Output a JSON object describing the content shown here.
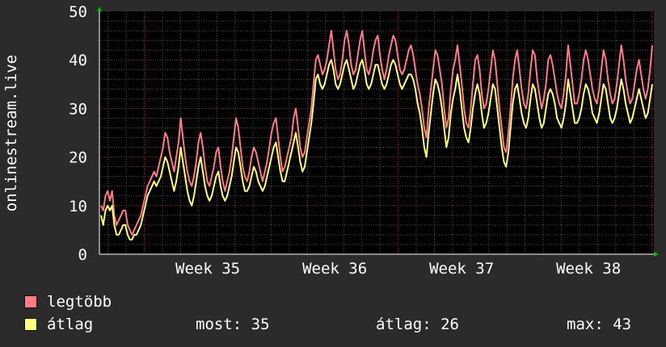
{
  "chart_data": {
    "type": "line",
    "ylabel": "onlinestream.live",
    "ylim": [
      0,
      50
    ],
    "yticks": [
      0,
      10,
      20,
      30,
      40,
      50
    ],
    "xticks": [
      "Week 35",
      "Week 36",
      "Week 37",
      "Week 38"
    ],
    "grid": true,
    "legend_position": "bottom-left",
    "series": [
      {
        "name": "legtöbb",
        "color": "#ff7b85",
        "values": [
          10,
          9,
          12,
          13,
          11,
          13,
          8,
          6,
          7,
          8,
          9,
          9,
          6,
          5,
          4,
          5,
          6,
          7,
          8,
          10,
          12,
          14,
          15,
          16,
          17,
          16,
          18,
          20,
          22,
          25,
          24,
          21,
          19,
          17,
          20,
          23,
          28,
          24,
          20,
          17,
          15,
          14,
          16,
          19,
          23,
          25,
          22,
          18,
          15,
          14,
          16,
          18,
          21,
          22,
          18,
          15,
          13,
          15,
          17,
          20,
          24,
          28,
          26,
          22,
          18,
          16,
          15,
          17,
          20,
          22,
          21,
          19,
          17,
          15,
          17,
          19,
          22,
          25,
          27,
          28,
          24,
          20,
          17,
          18,
          20,
          22,
          24,
          28,
          30,
          26,
          22,
          20,
          21,
          24,
          27,
          30,
          35,
          40,
          41,
          39,
          37,
          38,
          40,
          43,
          46,
          42,
          38,
          36,
          37,
          40,
          44,
          46,
          43,
          39,
          37,
          38,
          41,
          44,
          46,
          42,
          38,
          37,
          39,
          42,
          44,
          45,
          41,
          38,
          36,
          38,
          41,
          43,
          45,
          44,
          41,
          38,
          37,
          38,
          40,
          42,
          43,
          41,
          38,
          35,
          33,
          30,
          26,
          24,
          30,
          34,
          38,
          42,
          41,
          38,
          35,
          30,
          26,
          28,
          34,
          38,
          40,
          43,
          39,
          35,
          30,
          27,
          26,
          30,
          35,
          40,
          41,
          38,
          33,
          30,
          31,
          34,
          38,
          42,
          40,
          35,
          30,
          26,
          22,
          21,
          25,
          30,
          36,
          40,
          42,
          38,
          34,
          31,
          30,
          33,
          38,
          42,
          41,
          36,
          33,
          30,
          32,
          35,
          40,
          41,
          39,
          36,
          33,
          31,
          30,
          33,
          37,
          43,
          39,
          35,
          31,
          31,
          33,
          36,
          40,
          42,
          40,
          37,
          34,
          32,
          31,
          34,
          38,
          42,
          40,
          36,
          33,
          31,
          32,
          35,
          39,
          43,
          40,
          36,
          33,
          31,
          32,
          35,
          38,
          40,
          37,
          34,
          32,
          34,
          38,
          43
        ],
        "now": "",
        "avg": "",
        "max": ""
      },
      {
        "name": "átlag",
        "color": "#ffff80",
        "values": [
          8,
          6,
          9,
          10,
          9,
          10,
          6,
          4,
          4,
          5,
          6,
          6,
          4,
          3,
          3,
          4,
          4,
          5,
          6,
          8,
          10,
          12,
          13,
          14,
          15,
          14,
          15,
          16,
          18,
          20,
          19,
          17,
          15,
          13,
          15,
          18,
          22,
          19,
          16,
          13,
          11,
          10,
          12,
          15,
          18,
          20,
          17,
          14,
          12,
          11,
          12,
          14,
          16,
          17,
          14,
          12,
          11,
          12,
          14,
          16,
          19,
          22,
          21,
          18,
          15,
          13,
          13,
          14,
          16,
          18,
          17,
          15,
          14,
          13,
          14,
          16,
          18,
          20,
          22,
          23,
          20,
          17,
          15,
          15,
          17,
          19,
          21,
          23,
          25,
          22,
          19,
          17,
          18,
          21,
          24,
          27,
          31,
          36,
          37,
          35,
          34,
          35,
          37,
          39,
          40,
          38,
          35,
          34,
          35,
          37,
          39,
          40,
          38,
          36,
          34,
          35,
          37,
          39,
          40,
          38,
          35,
          34,
          35,
          37,
          39,
          39,
          37,
          35,
          34,
          35,
          37,
          39,
          40,
          39,
          37,
          35,
          34,
          35,
          36,
          37,
          37,
          36,
          34,
          31,
          29,
          26,
          22,
          20,
          25,
          29,
          33,
          36,
          35,
          33,
          30,
          26,
          22,
          24,
          29,
          32,
          34,
          37,
          34,
          30,
          26,
          24,
          23,
          26,
          30,
          33,
          35,
          33,
          29,
          26,
          27,
          29,
          32,
          35,
          34,
          30,
          26,
          22,
          19,
          18,
          21,
          26,
          31,
          34,
          35,
          32,
          29,
          27,
          26,
          28,
          32,
          35,
          34,
          31,
          28,
          26,
          27,
          30,
          33,
          34,
          33,
          31,
          28,
          27,
          26,
          28,
          31,
          36,
          33,
          30,
          27,
          27,
          28,
          30,
          33,
          35,
          34,
          32,
          29,
          28,
          27,
          29,
          32,
          35,
          34,
          31,
          28,
          27,
          28,
          30,
          33,
          36,
          34,
          31,
          29,
          27,
          28,
          30,
          32,
          34,
          32,
          30,
          28,
          29,
          32,
          35
        ],
        "now": "35",
        "avg": "26",
        "max": "43"
      }
    ]
  },
  "stats": {
    "now_label": "most:",
    "avg_label": "átlag:",
    "max_label": "max:"
  }
}
